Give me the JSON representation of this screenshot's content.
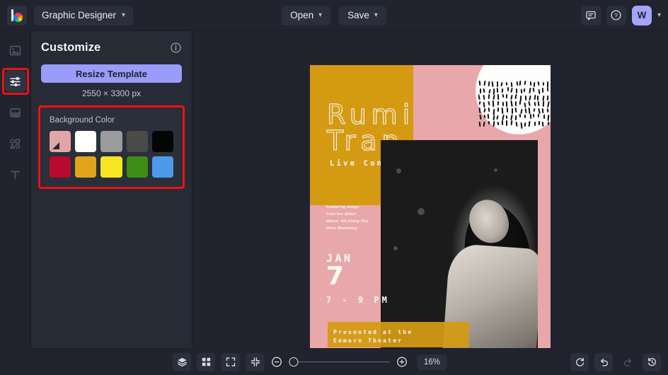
{
  "app": {
    "logo_icon": "color-wheel-logo",
    "document_name": "Graphic Designer"
  },
  "topbar": {
    "open_label": "Open",
    "save_label": "Save",
    "chat_icon": "chat-bubble-icon",
    "help_icon": "question-mark-circle-icon",
    "avatar_initial": "W",
    "account_caret": "chevron-down-icon",
    "open_caret": "chevron-down-icon",
    "save_caret": "chevron-down-icon",
    "doc_caret": "chevron-down-icon"
  },
  "rail": {
    "items": [
      {
        "name": "sidebar-item-image",
        "icon": "image-icon",
        "active": false,
        "highlighted": false
      },
      {
        "name": "sidebar-item-customize",
        "icon": "sliders-icon",
        "active": true,
        "highlighted": true
      },
      {
        "name": "sidebar-item-layout",
        "icon": "layout-icon",
        "active": false,
        "highlighted": false
      },
      {
        "name": "sidebar-item-elements",
        "icon": "shapes-icon",
        "active": false,
        "highlighted": false
      },
      {
        "name": "sidebar-item-text",
        "icon": "text-icon",
        "active": false,
        "highlighted": false
      }
    ]
  },
  "panel": {
    "title": "Customize",
    "info_icon": "info-circle-icon",
    "resize_label": "Resize Template",
    "dimensions": "2550 × 3300 px",
    "background": {
      "label": "Background Color",
      "highlighted": true,
      "swatches": [
        {
          "name": "swatch-pink",
          "hex": "#e2a5a7",
          "selected": true
        },
        {
          "name": "swatch-white",
          "hex": "#ffffff",
          "selected": false
        },
        {
          "name": "swatch-gray",
          "hex": "#9b9b9b",
          "selected": false
        },
        {
          "name": "swatch-dark-gray",
          "hex": "#4a4a48",
          "selected": false
        },
        {
          "name": "swatch-black",
          "hex": "#050505",
          "selected": false
        },
        {
          "name": "swatch-crimson",
          "hex": "#b70a2e",
          "selected": false
        },
        {
          "name": "swatch-amber",
          "hex": "#e2a419",
          "selected": false
        },
        {
          "name": "swatch-yellow",
          "hex": "#f6e521",
          "selected": false
        },
        {
          "name": "swatch-green",
          "hex": "#3d8c16",
          "selected": false
        },
        {
          "name": "swatch-blue",
          "hex": "#4c9aeb",
          "selected": false
        }
      ]
    }
  },
  "poster": {
    "title_line1": "Rumi",
    "title_line2": "Tran",
    "subtitle": "Live Concert",
    "body_text": "Featuring songs from her debut album 'All Along You Were Blooming'",
    "month": "JAN",
    "day": "7",
    "time": "7 - 9 PM",
    "banner_line1": "Presented at the",
    "banner_line2": "Enmore Theater",
    "colors": {
      "background": "#e7a7ab",
      "gold": "#d49a12",
      "ink": "#fdfbf5"
    }
  },
  "bottombar": {
    "layers_icon": "layers-icon",
    "grid_icon": "grid-icon",
    "fullscreen_icon": "fullscreen-icon",
    "fit_icon": "fit-to-screen-icon",
    "zoom_out_icon": "zoom-out-icon",
    "zoom_in_icon": "zoom-in-icon",
    "zoom_value": "16%",
    "zoom_slider_position": 0,
    "reset_icon": "refresh-icon",
    "undo_icon": "undo-icon",
    "redo_icon": "redo-icon",
    "history_icon": "history-icon"
  }
}
